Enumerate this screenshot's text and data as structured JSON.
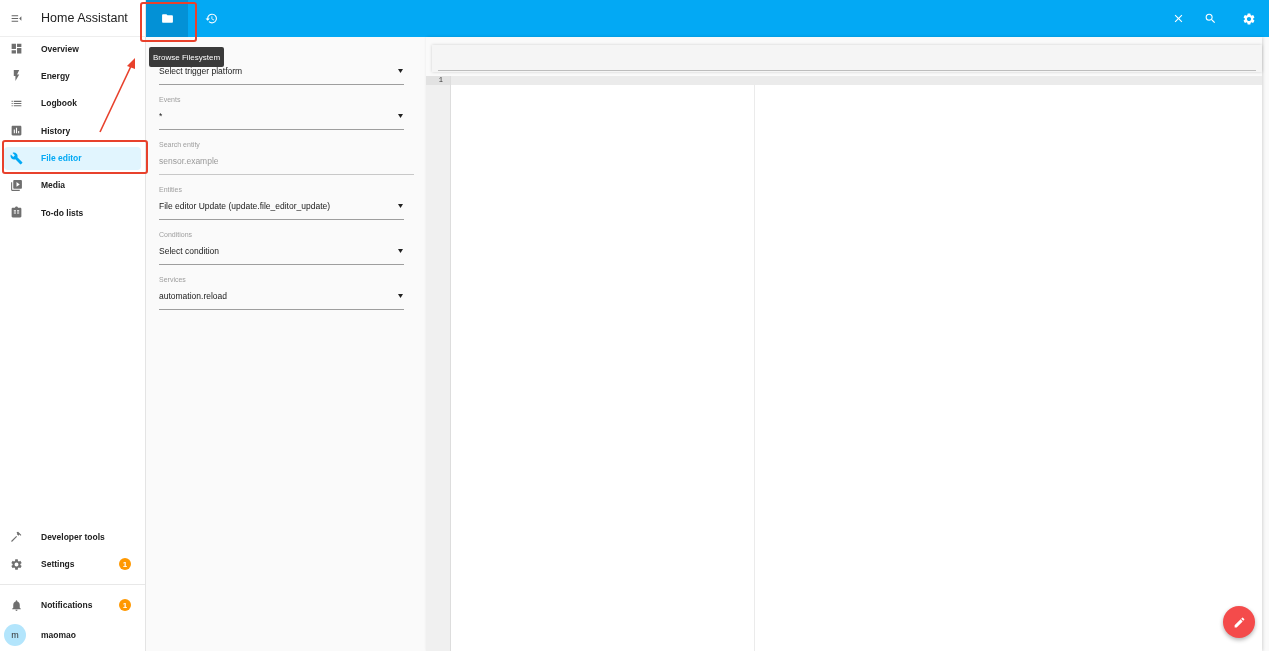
{
  "sidebar": {
    "title": "Home Assistant",
    "items": [
      {
        "label": "Overview",
        "selected": false
      },
      {
        "label": "Energy",
        "selected": false
      },
      {
        "label": "Logbook",
        "selected": false
      },
      {
        "label": "History",
        "selected": false
      },
      {
        "label": "File editor",
        "selected": true
      },
      {
        "label": "Media",
        "selected": false
      },
      {
        "label": "To-do lists",
        "selected": false
      }
    ],
    "bottom_items": [
      {
        "label": "Developer tools"
      },
      {
        "label": "Settings",
        "badge": "1"
      }
    ],
    "notifications": {
      "label": "Notifications",
      "badge": "1"
    },
    "user": {
      "initial": "m",
      "name": "maomao"
    }
  },
  "toolbar": {
    "buttons": [
      {
        "selected": true
      },
      {
        "selected": false
      }
    ],
    "tooltip": "Browse Filesystem"
  },
  "form": {
    "fields": [
      {
        "kind": "select",
        "value": "Select trigger platform"
      },
      {
        "kind": "select",
        "label": "Events",
        "value": "*"
      },
      {
        "kind": "text",
        "label": "Search entity",
        "placeholder": "sensor.example"
      },
      {
        "kind": "select",
        "label": "Entities",
        "value": "File editor Update (update.file_editor_update)"
      },
      {
        "kind": "select",
        "label": "Conditions",
        "value": "Select condition"
      },
      {
        "kind": "select",
        "label": "Services",
        "value": "automation.reload"
      }
    ]
  },
  "editor": {
    "line_numbers": [
      "1"
    ]
  }
}
